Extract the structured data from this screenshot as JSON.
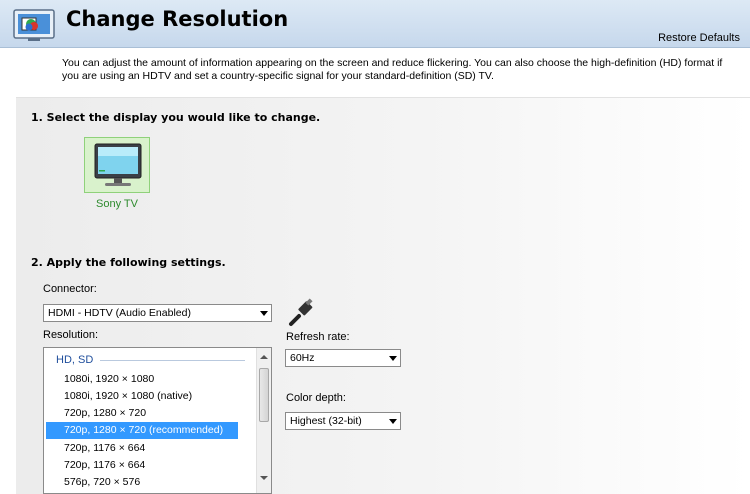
{
  "header": {
    "title": "Change Resolution",
    "restore_label": "Restore Defaults"
  },
  "description": "You can adjust the amount of information appearing on the screen and reduce flickering. You can also choose the high-definition (HD) format if you are using an HDTV and set a country-specific signal for your standard-definition (SD) TV.",
  "section1": {
    "title": "1. Select the display you would like to change.",
    "display_label": "Sony TV"
  },
  "section2": {
    "title": "2. Apply the following settings.",
    "connector_label": "Connector:",
    "connector_value": "HDMI - HDTV (Audio Enabled)",
    "resolution_label": "Resolution:",
    "refresh_label": "Refresh rate:",
    "refresh_value": "60Hz",
    "color_label": "Color depth:",
    "color_value": "Highest (32-bit)"
  },
  "resolution_list": {
    "group": "HD, SD",
    "items": [
      "1080i, 1920 × 1080",
      "1080i, 1920 × 1080 (native)",
      "720p, 1280 × 720",
      "720p, 1280 × 720 (recommended)",
      "720p, 1176 × 664",
      "720p, 1176 × 664",
      "576p, 720 × 576"
    ],
    "selected_index": 3
  },
  "colors": {
    "accent": "#3399ff",
    "selected_display_bg": "#d9f2cc",
    "display_label": "#2e8b2e",
    "group_header": "#1f4e9c"
  }
}
